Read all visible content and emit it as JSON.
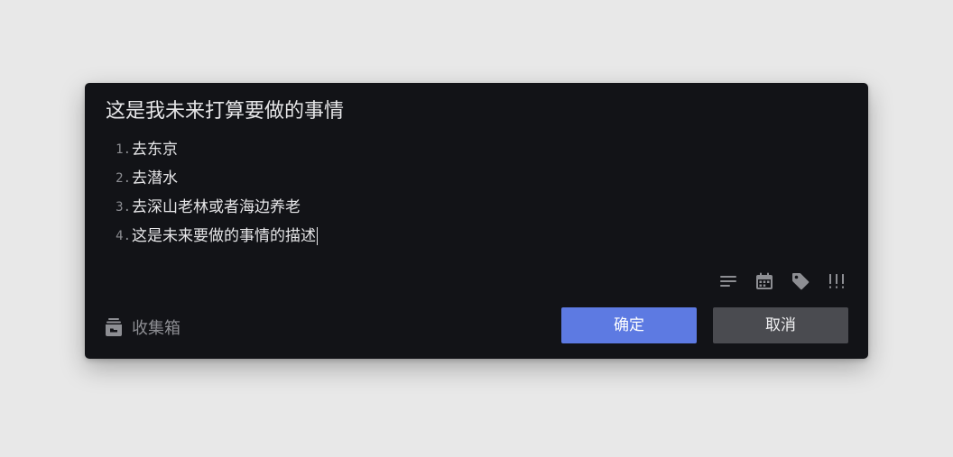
{
  "task": {
    "title": "这是我未来打算要做的事情",
    "description_items": [
      {
        "num": "1.",
        "text": "去东京"
      },
      {
        "num": "2.",
        "text": "去潜水"
      },
      {
        "num": "3.",
        "text": "去深山老林或者海边养老"
      },
      {
        "num": "4.",
        "text": "这是未来要做的事情的描述"
      }
    ]
  },
  "toolbar": {
    "icons": [
      "description-icon",
      "calendar-icon",
      "tag-icon",
      "priority-icon"
    ],
    "priority_label": "!!!"
  },
  "project": {
    "icon": "inbox-icon",
    "label": "收集箱"
  },
  "buttons": {
    "confirm_label": "确定",
    "cancel_label": "取消"
  },
  "colors": {
    "dialog_bg": "#121317",
    "accent": "#5d7ae2",
    "cancel_bg": "#4a4b50",
    "muted_icon": "#8d8e93"
  }
}
